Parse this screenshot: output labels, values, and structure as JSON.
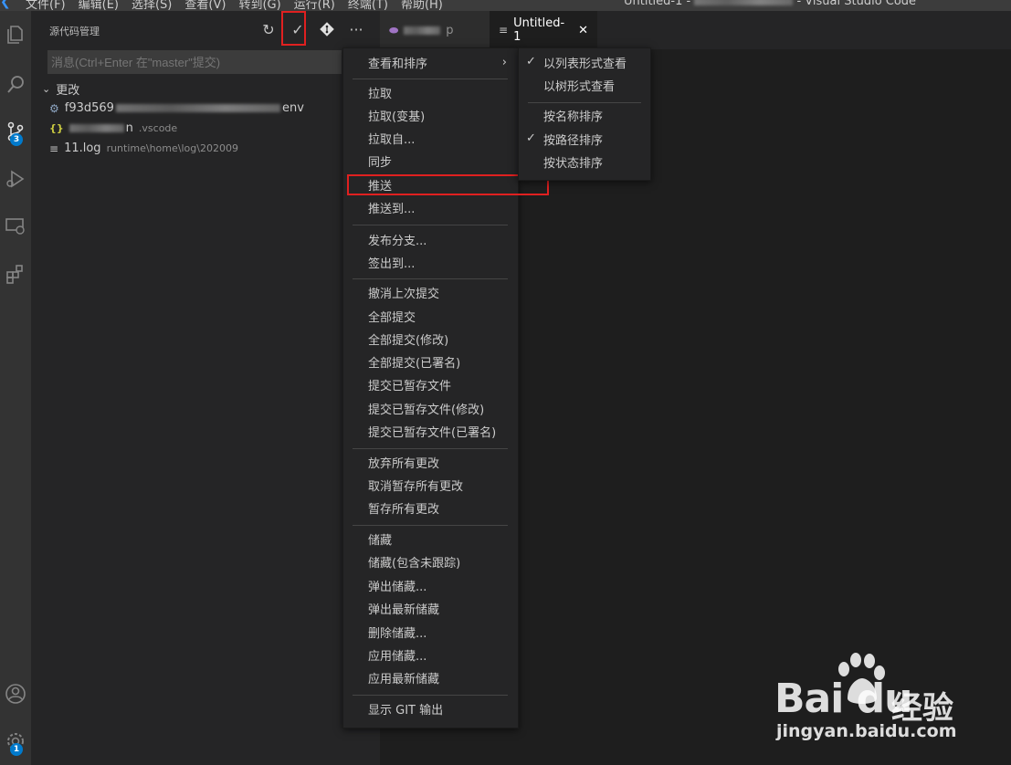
{
  "titlebar": {
    "menu": [
      "文件(F)",
      "编辑(E)",
      "选择(S)",
      "查看(V)",
      "转到(G)",
      "运行(R)",
      "终端(T)",
      "帮助(H)"
    ],
    "window_title_prefix": "Untitled-1 - ",
    "window_title_suffix": " - Visual Studio Code"
  },
  "activitybar": {
    "scm_badge": "3",
    "settings_badge": "1"
  },
  "sidebar": {
    "title": "源代码管理",
    "message_placeholder": "消息(Ctrl+Enter 在\"master\"提交)",
    "changes_label": "更改",
    "files": [
      {
        "name_prefix": "f93d569",
        "name_suffix": "env",
        "path": ""
      },
      {
        "name_prefix": "",
        "name_suffix": "n",
        "path": ".vscode"
      },
      {
        "name_prefix": "11.log",
        "name_suffix": "",
        "path": "runtime\\home\\log\\202009"
      }
    ]
  },
  "tabs": [
    {
      "label": "p",
      "active": false
    },
    {
      "label": "Untitled-1",
      "active": true
    }
  ],
  "context_menu": {
    "view_sort": "查看和排序",
    "group1": [
      "拉取",
      "拉取(变基)",
      "拉取自...",
      "同步",
      "推送",
      "推送到..."
    ],
    "group2": [
      "发布分支...",
      "签出到..."
    ],
    "group3": [
      "撤消上次提交",
      "全部提交",
      "全部提交(修改)",
      "全部提交(已署名)",
      "提交已暂存文件",
      "提交已暂存文件(修改)",
      "提交已暂存文件(已署名)"
    ],
    "group4": [
      "放弃所有更改",
      "取消暂存所有更改",
      "暂存所有更改"
    ],
    "group5": [
      "储藏",
      "储藏(包含未跟踪)",
      "弹出储藏...",
      "弹出最新储藏",
      "删除储藏...",
      "应用储藏...",
      "应用最新储藏"
    ],
    "group6": [
      "显示 GIT 输出"
    ]
  },
  "submenu": {
    "items": [
      "以列表形式查看",
      "以树形式查看",
      "按名称排序",
      "按路径排序",
      "按状态排序"
    ],
    "checked": [
      "以列表形式查看",
      "按路径排序"
    ]
  },
  "watermark": {
    "logo": "Bai du",
    "cn": "经验",
    "url": "jingyan.baidu.com"
  },
  "colors": {
    "accent": "#007acc",
    "highlight_box": "#e02020"
  }
}
